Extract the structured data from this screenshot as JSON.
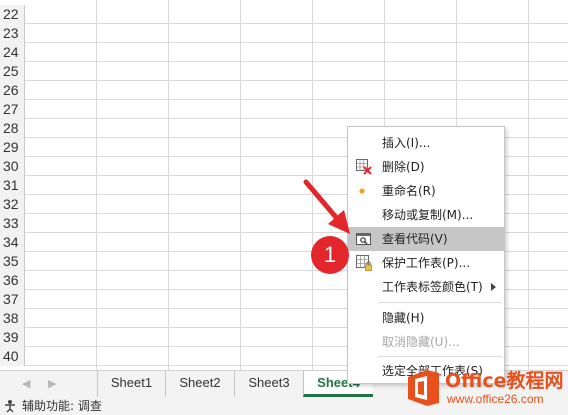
{
  "rows": [
    "22",
    "23",
    "24",
    "25",
    "26",
    "27",
    "28",
    "29",
    "30",
    "31",
    "32",
    "33",
    "34",
    "35",
    "36",
    "37",
    "38",
    "39",
    "40"
  ],
  "sheet_tabs": [
    {
      "label": "Sheet1",
      "active": false
    },
    {
      "label": "Sheet2",
      "active": false
    },
    {
      "label": "Sheet3",
      "active": false
    },
    {
      "label": "Sheet4",
      "active": true
    }
  ],
  "status": {
    "text": "辅助功能: 调查"
  },
  "context_menu": {
    "items": [
      {
        "label": "插入(I)...",
        "icon": "none"
      },
      {
        "label": "删除(D)",
        "icon": "delete-sheet-icon"
      },
      {
        "label": "重命名(R)",
        "icon": "bullet-icon"
      },
      {
        "label": "移动或复制(M)...",
        "icon": "none"
      },
      {
        "label": "查看代码(V)",
        "icon": "view-code-icon",
        "highlighted": true
      },
      {
        "label": "保护工作表(P)...",
        "icon": "protect-sheet-icon"
      },
      {
        "label": "工作表标签颜色(T)",
        "icon": "submenu-arrow-icon"
      },
      {
        "label": "隐藏(H)",
        "icon": "none"
      },
      {
        "label": "取消隐藏(U)...",
        "icon": "none",
        "disabled": true
      },
      {
        "label": "选定全部工作表(S)",
        "icon": "none"
      }
    ]
  },
  "annotation": {
    "number": "1"
  },
  "watermark": {
    "brand": "Office教程网",
    "url": "www.office26.com"
  },
  "colors": {
    "accent": "#217346",
    "badge": "#e2262b",
    "logo": "#e8501e"
  }
}
